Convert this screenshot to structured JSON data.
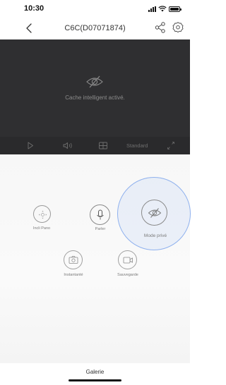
{
  "status_bar": {
    "time": "10:30"
  },
  "nav": {
    "title": "C6C(D07071874)"
  },
  "video": {
    "message": "Cache intelligent activé."
  },
  "video_controls": {
    "quality_label": "Standard"
  },
  "controls": {
    "init_pano_label": "Incli Pano",
    "speak_label": "Parler",
    "privacy_label": "Mode privé",
    "snapshot_label": "Instantanté",
    "record_label": "Sauvegarde"
  },
  "footer": {
    "gallery_label": "Galerie"
  },
  "colors": {
    "video_bg": "#2f2f31",
    "controls_bg": "#2a2a2c",
    "privacy_accent": "#8fb1ee"
  }
}
